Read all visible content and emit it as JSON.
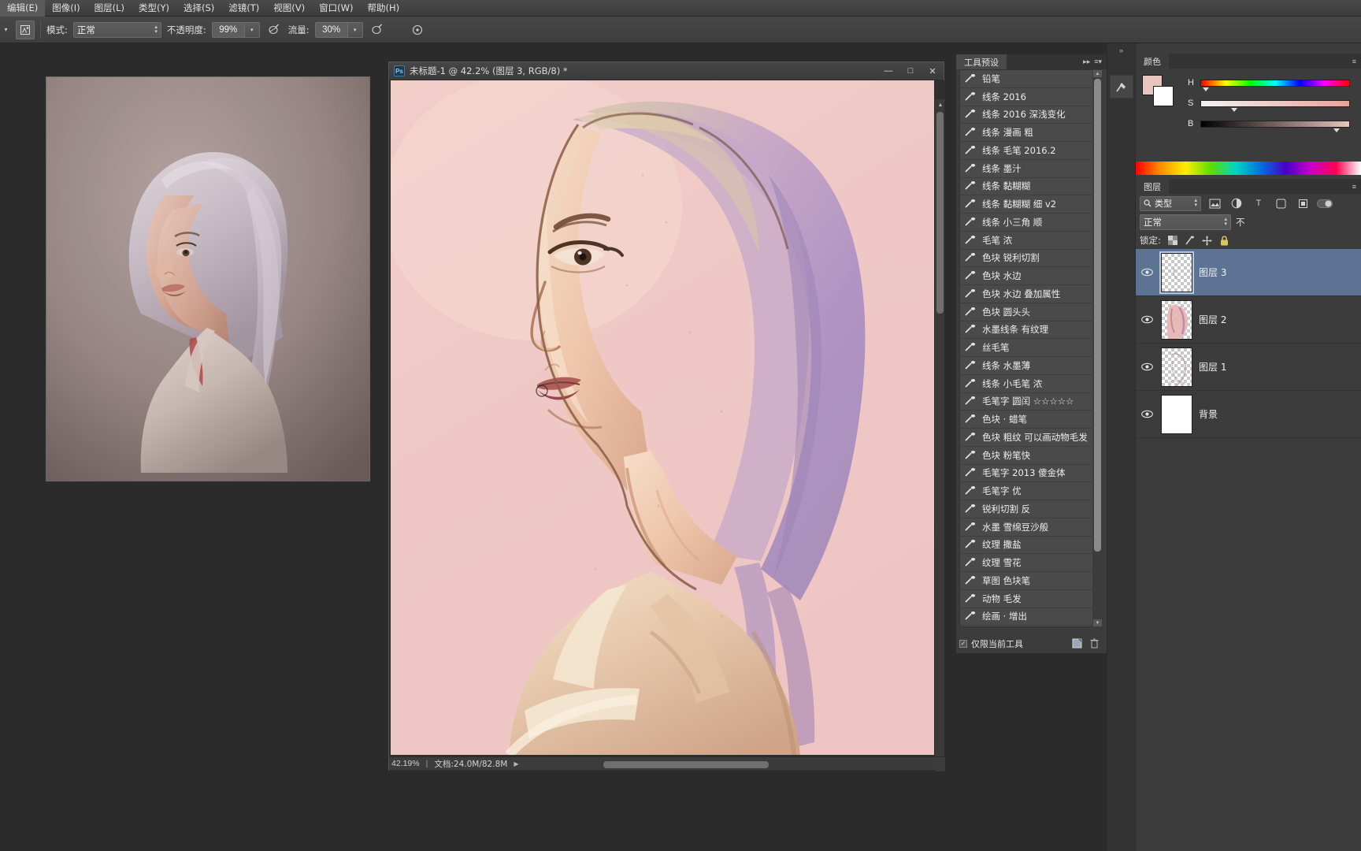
{
  "menubar": {
    "items": [
      {
        "label": "编辑(E)"
      },
      {
        "label": "图像(I)"
      },
      {
        "label": "图层(L)"
      },
      {
        "label": "类型(Y)"
      },
      {
        "label": "选择(S)"
      },
      {
        "label": "滤镜(T)"
      },
      {
        "label": "视图(V)"
      },
      {
        "label": "窗口(W)"
      },
      {
        "label": "帮助(H)"
      }
    ]
  },
  "options_bar": {
    "mode_label": "模式:",
    "mode_value": "正常",
    "opacity_label": "不透明度:",
    "opacity_value": "99%",
    "flow_label": "流量:",
    "flow_value": "30%"
  },
  "document": {
    "title": "未标题-1 @ 42.2% (图层 3, RGB/8) *",
    "ps_badge": "Ps",
    "minimize": "—",
    "maximize": "□",
    "close": "✕",
    "zoom_status": "42.19%",
    "doc_status": "文档:24.0M/82.8M"
  },
  "tool_presets": {
    "tab_label": "工具预设",
    "collapse_icon": "chevron-right-icon",
    "menu_icon": "panel-menu-icon",
    "footer_label": "仅限当前工具",
    "footer_checked": "✓",
    "items": [
      {
        "label": "铅笔"
      },
      {
        "label": "线条 2016"
      },
      {
        "label": "线条 2016 深浅变化"
      },
      {
        "label": "线条 漫画 粗"
      },
      {
        "label": "线条 毛笔 2016.2"
      },
      {
        "label": "线条 墨汁"
      },
      {
        "label": "线条 黏糊糊"
      },
      {
        "label": "线条 黏糊糊 细 v2"
      },
      {
        "label": "线条 小三角 顺"
      },
      {
        "label": "毛笔 浓"
      },
      {
        "label": "色块 锐利切割"
      },
      {
        "label": "色块 水边"
      },
      {
        "label": "色块 水边 叠加属性"
      },
      {
        "label": "色块 圆头头"
      },
      {
        "label": "水墨线条 有纹理"
      },
      {
        "label": "丝毛笔"
      },
      {
        "label": "线条 水墨薄"
      },
      {
        "label": "线条 小毛笔 浓"
      },
      {
        "label": "毛笔字 圆闰 ☆☆☆☆☆"
      },
      {
        "label": "色块 · 蜡笔"
      },
      {
        "label": "色块 粗纹 可以画动物毛发"
      },
      {
        "label": "色块 粉笔快"
      },
      {
        "label": "毛笔字 2013 傻金体"
      },
      {
        "label": "毛笔字 优"
      },
      {
        "label": "锐利切割 反"
      },
      {
        "label": "水墨 雪绵豆沙般"
      },
      {
        "label": "纹理 撒盐"
      },
      {
        "label": "纹理 雪花"
      },
      {
        "label": "草图 色块笔"
      },
      {
        "label": "动物 毛发"
      },
      {
        "label": "绘画 · 增出"
      }
    ]
  },
  "color_panel": {
    "tab_label": "颜色",
    "foreground_color": "#e8c4bf",
    "background_color": "#ffffff",
    "sliders": [
      {
        "letter": "H",
        "value_pct": 2
      },
      {
        "letter": "S",
        "value_pct": 22
      },
      {
        "letter": "B",
        "value_pct": 91
      }
    ]
  },
  "layers_panel": {
    "tab_label": "图层",
    "filter_label": "类型",
    "search_icon": "search-icon",
    "blend_mode": "正常",
    "opacity_label": "不",
    "lock_label": "锁定:",
    "lock_icons": [
      "checkerboard-icon",
      "brush-icon",
      "move-icon",
      "lock-icon"
    ],
    "layers": [
      {
        "name": "图层 3",
        "visible": true,
        "selected": true,
        "thumb": "transparent"
      },
      {
        "name": "图层 2",
        "visible": true,
        "selected": false,
        "thumb": "pink-portrait"
      },
      {
        "name": "图层 1",
        "visible": true,
        "selected": false,
        "thumb": "light-sketch"
      },
      {
        "name": "背景",
        "visible": true,
        "selected": false,
        "thumb": "white"
      }
    ]
  },
  "right_rail": {
    "collapse_icon": "double-chevron-right-icon",
    "icons": [
      "history-brush-icon"
    ]
  }
}
